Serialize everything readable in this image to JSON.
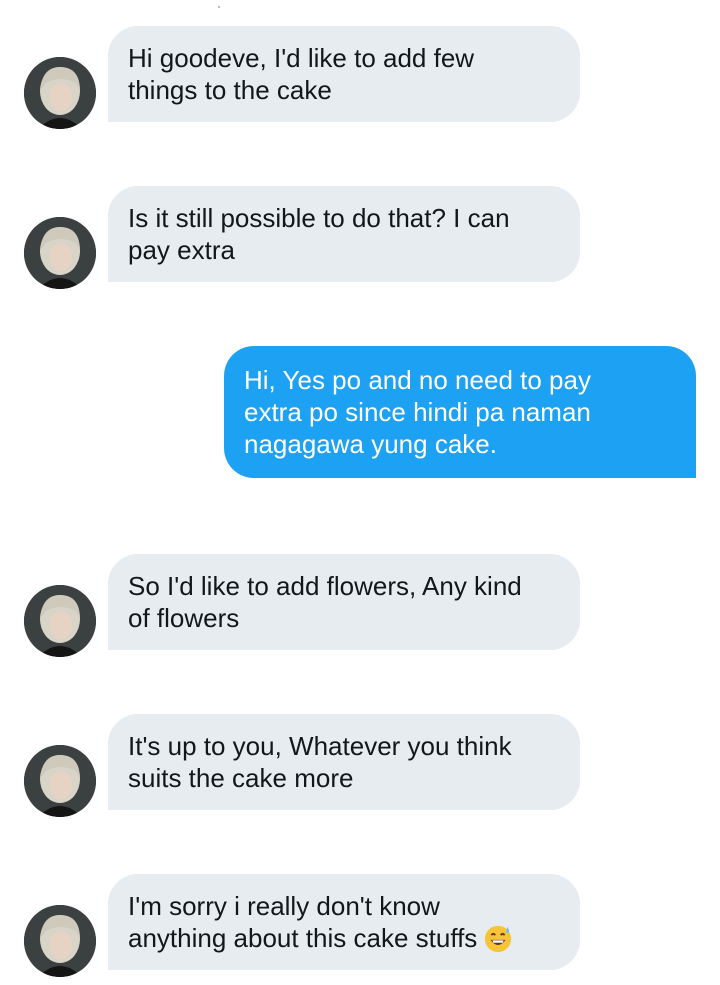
{
  "conversation": {
    "messages": [
      {
        "direction": "incoming",
        "text": "Hi goodeve, I'd like to add few\nthings to the cake"
      },
      {
        "direction": "incoming",
        "text": "Is it still possible to do that? I can\npay extra"
      },
      {
        "direction": "outgoing",
        "text": "Hi, Yes po and no need to pay\nextra po since hindi pa naman\nnagagawa yung cake."
      },
      {
        "direction": "incoming",
        "text": "So I'd like to add flowers, Any kind\nof flowers"
      },
      {
        "direction": "incoming",
        "text": "It's up to you, Whatever you think\nsuits the cake more"
      },
      {
        "direction": "incoming",
        "text": "I'm sorry i really don't know\nanything about this cake stuffs",
        "emoji": "grinning-face-with-sweat-icon"
      }
    ]
  },
  "colors": {
    "incoming_bubble": "#e6ecf0",
    "outgoing_bubble": "#1da1f2",
    "incoming_text": "#14171a",
    "outgoing_text": "#ffffff"
  }
}
